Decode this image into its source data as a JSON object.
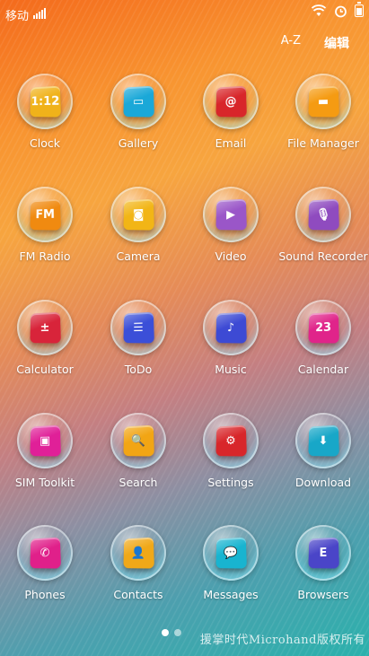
{
  "status_bar": {
    "carrier": "移动",
    "icons": [
      "signal-icon",
      "wifi-icon",
      "alarm-icon",
      "battery-icon"
    ]
  },
  "top_actions": {
    "sort_label": "A-Z",
    "edit_label": "编辑"
  },
  "apps": [
    {
      "label": "Clock",
      "glyph": "1:12",
      "icon": "clock-icon",
      "color": "#f0b21a"
    },
    {
      "label": "Gallery",
      "glyph": "▭",
      "icon": "gallery-icon",
      "color": "#1aa8d8"
    },
    {
      "label": "Email",
      "glyph": "@",
      "icon": "email-icon",
      "color": "#d8262a"
    },
    {
      "label": "File Manager",
      "glyph": "▬",
      "icon": "folder-icon",
      "color": "#f59b12"
    },
    {
      "label": "FM Radio",
      "glyph": "FM",
      "icon": "radio-icon",
      "color": "#f08a10"
    },
    {
      "label": "Camera",
      "glyph": "◙",
      "icon": "camera-icon",
      "color": "#f2b516"
    },
    {
      "label": "Video",
      "glyph": "▶",
      "icon": "video-icon",
      "color": "#9a56c8"
    },
    {
      "label": "Sound Recorder",
      "glyph": "🎙",
      "icon": "microphone-icon",
      "color": "#8f4bbf"
    },
    {
      "label": "Calculator",
      "glyph": "±",
      "icon": "calculator-icon",
      "color": "#d8243a"
    },
    {
      "label": "ToDo",
      "glyph": "☰",
      "icon": "todo-icon",
      "color": "#3b4fd8"
    },
    {
      "label": "Music",
      "glyph": "♪",
      "icon": "music-icon",
      "color": "#3d4ad4"
    },
    {
      "label": "Calendar",
      "glyph": "23",
      "icon": "calendar-icon",
      "color": "#e0248a"
    },
    {
      "label": "SIM Toolkit",
      "glyph": "▣",
      "icon": "sim-icon",
      "color": "#e02098"
    },
    {
      "label": "Search",
      "glyph": "🔍",
      "icon": "search-icon",
      "color": "#f2a514"
    },
    {
      "label": "Settings",
      "glyph": "⚙",
      "icon": "gear-icon",
      "color": "#d8262a"
    },
    {
      "label": "Download",
      "glyph": "⬇",
      "icon": "download-icon",
      "color": "#18a7c8"
    },
    {
      "label": "Phones",
      "glyph": "✆",
      "icon": "phone-icon",
      "color": "#e0208a"
    },
    {
      "label": "Contacts",
      "glyph": "👤",
      "icon": "contacts-icon",
      "color": "#f0a818"
    },
    {
      "label": "Messages",
      "glyph": "💬",
      "icon": "messages-icon",
      "color": "#18b4d0"
    },
    {
      "label": "Browsers",
      "glyph": "E",
      "icon": "browser-icon",
      "color": "#4a45c8"
    }
  ],
  "page_indicator": {
    "pages": 2,
    "current": 1
  },
  "watermark": "援掌时代Microhand版权所有"
}
